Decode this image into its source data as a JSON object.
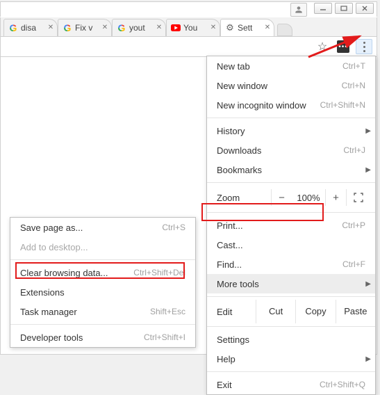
{
  "tabs": [
    {
      "title": "disa",
      "kind": "google"
    },
    {
      "title": "Fix v",
      "kind": "google"
    },
    {
      "title": "yout",
      "kind": "google"
    },
    {
      "title": "You",
      "kind": "youtube"
    },
    {
      "title": "Sett",
      "kind": "gear",
      "active": true
    }
  ],
  "window_controls": {
    "minimize": "—",
    "maximize": "▢",
    "close": "✕"
  },
  "main_menu": {
    "new_tab": {
      "label": "New tab",
      "shortcut": "Ctrl+T"
    },
    "new_window": {
      "label": "New window",
      "shortcut": "Ctrl+N"
    },
    "new_incognito": {
      "label": "New incognito window",
      "shortcut": "Ctrl+Shift+N"
    },
    "history": {
      "label": "History",
      "submenu": true
    },
    "downloads": {
      "label": "Downloads",
      "shortcut": "Ctrl+J"
    },
    "bookmarks": {
      "label": "Bookmarks",
      "submenu": true
    },
    "zoom": {
      "label": "Zoom",
      "minus": "−",
      "value": "100%",
      "plus": "+"
    },
    "print": {
      "label": "Print...",
      "shortcut": "Ctrl+P"
    },
    "cast": {
      "label": "Cast..."
    },
    "find": {
      "label": "Find...",
      "shortcut": "Ctrl+F"
    },
    "more_tools": {
      "label": "More tools",
      "submenu": true
    },
    "edit": {
      "label": "Edit",
      "cut": "Cut",
      "copy": "Copy",
      "paste": "Paste"
    },
    "settings": {
      "label": "Settings"
    },
    "help": {
      "label": "Help",
      "submenu": true
    },
    "exit": {
      "label": "Exit",
      "shortcut": "Ctrl+Shift+Q"
    }
  },
  "sub_menu": {
    "save_page": {
      "label": "Save page as...",
      "shortcut": "Ctrl+S"
    },
    "add_desktop": {
      "label": "Add to desktop..."
    },
    "clear_data": {
      "label": "Clear browsing data...",
      "shortcut": "Ctrl+Shift+Del"
    },
    "extensions": {
      "label": "Extensions"
    },
    "task_manager": {
      "label": "Task manager",
      "shortcut": "Shift+Esc"
    },
    "dev_tools": {
      "label": "Developer tools",
      "shortcut": "Ctrl+Shift+I"
    }
  }
}
